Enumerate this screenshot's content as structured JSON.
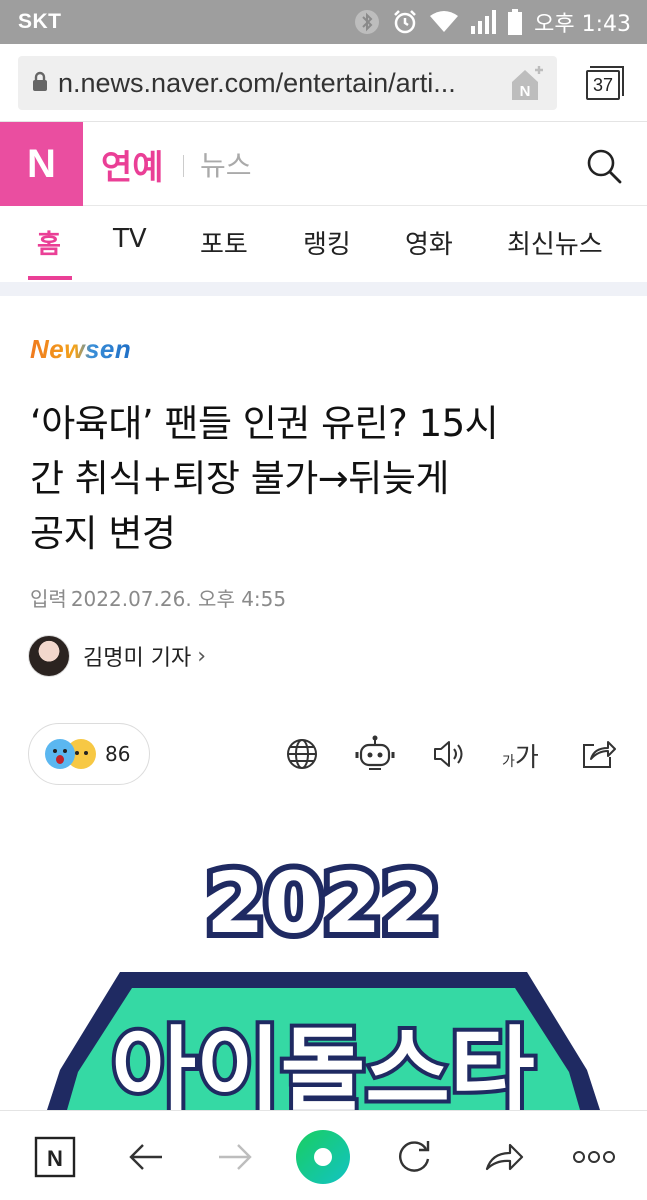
{
  "status_bar": {
    "carrier": "SKT",
    "time": "오후 1:43",
    "icons": [
      "bluetooth-icon",
      "alarm-icon",
      "wifi-icon",
      "signal-icon",
      "battery-icon"
    ]
  },
  "browser": {
    "url": "n.news.naver.com/entertain/arti...",
    "tab_count": "37"
  },
  "header": {
    "logo": "N",
    "section": "연예",
    "subsection": "뉴스"
  },
  "nav": {
    "tabs": [
      {
        "label": "홈",
        "active": true
      },
      {
        "label": "TV",
        "active": false
      },
      {
        "label": "포토",
        "active": false
      },
      {
        "label": "랭킹",
        "active": false
      },
      {
        "label": "영화",
        "active": false
      },
      {
        "label": "최신뉴스",
        "active": false
      }
    ]
  },
  "article": {
    "press": "Newsen",
    "headline_lines": [
      "‘아육대’ 팬들 인권 유린? 15시",
      "간 취식+퇴장 불가→뒤늦게",
      "공지 변경"
    ],
    "date_label": "입력",
    "date": "2022.07.26. 오후 4:55",
    "reporter": "김명미 기자",
    "reaction_count": "86",
    "fontsize_small": "가",
    "fontsize_large": "가",
    "image_text": {
      "year": "2022",
      "title": "아이돌스타"
    }
  },
  "colors": {
    "naver_pink": "#ea4ea0",
    "accent_pink": "#ea3f96",
    "status_bar": "#9e9e9e",
    "naver_green": "#19ce60",
    "logo_navy": "#1f2a62",
    "logo_mint": "#35d9a4"
  }
}
